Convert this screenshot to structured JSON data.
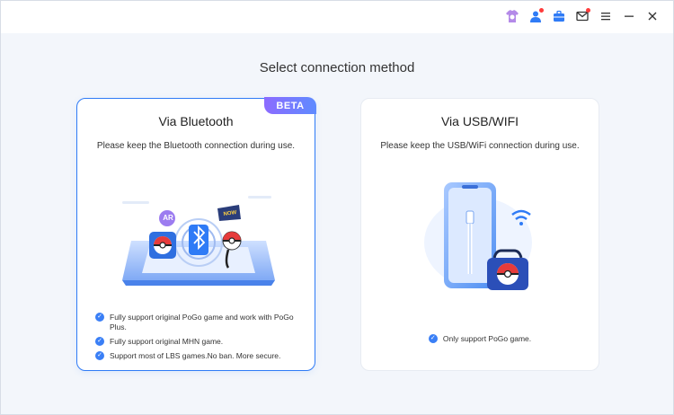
{
  "titlebar": {
    "icons": [
      "shirt-gift-icon",
      "user-icon",
      "toolbox-icon",
      "mail-icon",
      "menu-icon",
      "minimize-icon",
      "close-icon"
    ]
  },
  "heading": "Select connection method",
  "bluetooth_card": {
    "badge": "BETA",
    "title": "Via Bluetooth",
    "subtitle": "Please keep the Bluetooth connection during use.",
    "ar_label": "AR",
    "now_label": "NOW",
    "features": [
      "Fully support original PoGo game and work with PoGo Plus.",
      "Fully support original MHN game.",
      "Support most of LBS games.No ban. More secure."
    ]
  },
  "usb_card": {
    "title": "Via USB/WIFI",
    "subtitle": "Please keep the USB/WiFi connection during use.",
    "features": [
      "Only support PoGo game."
    ]
  },
  "colors": {
    "accent": "#2f7bf6",
    "badge_start": "#8c6bff",
    "badge_end": "#5f8bff",
    "background": "#f3f6fb"
  }
}
